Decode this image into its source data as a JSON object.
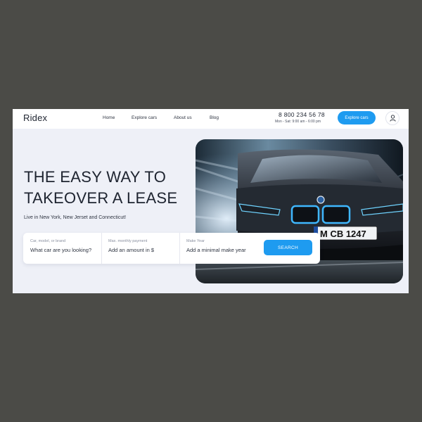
{
  "header": {
    "logo": "Ridex",
    "nav": [
      "Home",
      "Explore cars",
      "About us",
      "Blog"
    ],
    "phone": "8 800 234 56 78",
    "hours": "Mon - Sat: 9:00 am - 6:00 pm",
    "cta_label": "Explore cars",
    "profile_icon": "user-icon"
  },
  "hero": {
    "headline_line1": "THE EASY WAY TO",
    "headline_line2": "TAKEOVER A LEASE",
    "tagline": "Live in New York, New Jerset and Connecticut!",
    "plate": "M CB 1247"
  },
  "search": {
    "fields": [
      {
        "label": "Car, model, or brand",
        "placeholder": "What car are you looking?"
      },
      {
        "label": "Max. monthly payment",
        "placeholder": "Add an amount in $"
      },
      {
        "label": "Make Year",
        "placeholder": "Add a minimal make year"
      }
    ],
    "button_label": "SEARCH"
  },
  "colors": {
    "accent": "#1e9bf0",
    "background": "#eef0f7",
    "outer": "#4b4b47",
    "text": "#1e2430"
  }
}
